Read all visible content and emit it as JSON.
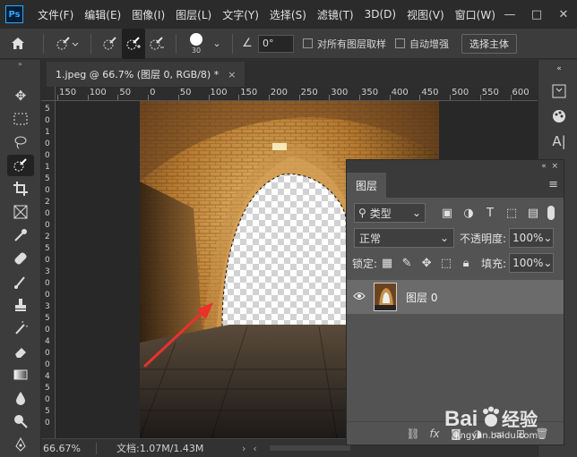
{
  "app": {
    "logo_text": "Ps"
  },
  "menu": [
    "文件(F)",
    "编辑(E)",
    "图像(I)",
    "图层(L)",
    "文字(Y)",
    "选择(S)",
    "滤镜(T)",
    "3D(D)",
    "视图(V)",
    "窗口(W)"
  ],
  "window_controls": {
    "minimize": "—",
    "maximize": "□",
    "close": "✕"
  },
  "options": {
    "brush_size": "30",
    "angle": "0°",
    "sample_all_layers": "对所有图层取样",
    "auto_enhance": "自动增强",
    "select_subject": "选择主体"
  },
  "document": {
    "tab_title": "1.jpeg @ 66.7% (图层 0, RGB/8) *",
    "close": "×"
  },
  "ruler": {
    "top_labels": [
      "150",
      "100",
      "50",
      "0",
      "50",
      "100",
      "150",
      "200",
      "250",
      "300",
      "350",
      "400",
      "450",
      "500",
      "550",
      "600"
    ],
    "left_labels": [
      "5",
      "0",
      "1",
      "0",
      "0",
      "1",
      "5",
      "0",
      "2",
      "0",
      "0",
      "2",
      "5",
      "0",
      "3",
      "0",
      "0",
      "3",
      "5",
      "0",
      "4",
      "0",
      "0",
      "4",
      "5",
      "0",
      "5",
      "0"
    ]
  },
  "status": {
    "zoom": "66.67%",
    "doc_info": "文档:1.07M/1.43M",
    "arrow": "›"
  },
  "layers_panel": {
    "tab": "图层",
    "filter_kind": "类型",
    "blend_mode": "正常",
    "opacity_label": "不透明度:",
    "opacity": "100%",
    "lock_label": "锁定:",
    "fill_label": "填充:",
    "fill": "100%",
    "layer_name": "图层 0",
    "bottom_icons": [
      "link-icon",
      "fx-icon",
      "mask-icon",
      "adjustment-icon",
      "group-icon",
      "new-layer-icon",
      "trash-icon"
    ]
  },
  "watermark": {
    "brand": "Bai",
    "brand2": "经验",
    "url": "jingyan.baidu.com"
  },
  "colors": {
    "accent": "#31a8ff",
    "annotation_arrow": "#e8322b"
  }
}
